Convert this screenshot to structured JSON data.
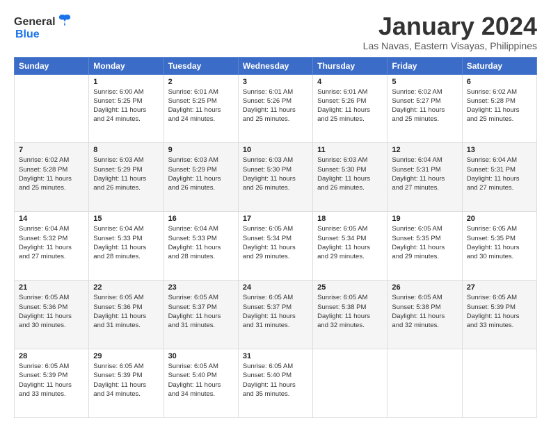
{
  "header": {
    "logo_general": "General",
    "logo_blue": "Blue",
    "title": "January 2024",
    "location": "Las Navas, Eastern Visayas, Philippines"
  },
  "weekdays": [
    "Sunday",
    "Monday",
    "Tuesday",
    "Wednesday",
    "Thursday",
    "Friday",
    "Saturday"
  ],
  "weeks": [
    [
      {
        "day": "",
        "sunrise": "",
        "sunset": "",
        "daylight": ""
      },
      {
        "day": "1",
        "sunrise": "Sunrise: 6:00 AM",
        "sunset": "Sunset: 5:25 PM",
        "daylight": "Daylight: 11 hours and 24 minutes."
      },
      {
        "day": "2",
        "sunrise": "Sunrise: 6:01 AM",
        "sunset": "Sunset: 5:25 PM",
        "daylight": "Daylight: 11 hours and 24 minutes."
      },
      {
        "day": "3",
        "sunrise": "Sunrise: 6:01 AM",
        "sunset": "Sunset: 5:26 PM",
        "daylight": "Daylight: 11 hours and 25 minutes."
      },
      {
        "day": "4",
        "sunrise": "Sunrise: 6:01 AM",
        "sunset": "Sunset: 5:26 PM",
        "daylight": "Daylight: 11 hours and 25 minutes."
      },
      {
        "day": "5",
        "sunrise": "Sunrise: 6:02 AM",
        "sunset": "Sunset: 5:27 PM",
        "daylight": "Daylight: 11 hours and 25 minutes."
      },
      {
        "day": "6",
        "sunrise": "Sunrise: 6:02 AM",
        "sunset": "Sunset: 5:28 PM",
        "daylight": "Daylight: 11 hours and 25 minutes."
      }
    ],
    [
      {
        "day": "7",
        "sunrise": "Sunrise: 6:02 AM",
        "sunset": "Sunset: 5:28 PM",
        "daylight": "Daylight: 11 hours and 25 minutes."
      },
      {
        "day": "8",
        "sunrise": "Sunrise: 6:03 AM",
        "sunset": "Sunset: 5:29 PM",
        "daylight": "Daylight: 11 hours and 26 minutes."
      },
      {
        "day": "9",
        "sunrise": "Sunrise: 6:03 AM",
        "sunset": "Sunset: 5:29 PM",
        "daylight": "Daylight: 11 hours and 26 minutes."
      },
      {
        "day": "10",
        "sunrise": "Sunrise: 6:03 AM",
        "sunset": "Sunset: 5:30 PM",
        "daylight": "Daylight: 11 hours and 26 minutes."
      },
      {
        "day": "11",
        "sunrise": "Sunrise: 6:03 AM",
        "sunset": "Sunset: 5:30 PM",
        "daylight": "Daylight: 11 hours and 26 minutes."
      },
      {
        "day": "12",
        "sunrise": "Sunrise: 6:04 AM",
        "sunset": "Sunset: 5:31 PM",
        "daylight": "Daylight: 11 hours and 27 minutes."
      },
      {
        "day": "13",
        "sunrise": "Sunrise: 6:04 AM",
        "sunset": "Sunset: 5:31 PM",
        "daylight": "Daylight: 11 hours and 27 minutes."
      }
    ],
    [
      {
        "day": "14",
        "sunrise": "Sunrise: 6:04 AM",
        "sunset": "Sunset: 5:32 PM",
        "daylight": "Daylight: 11 hours and 27 minutes."
      },
      {
        "day": "15",
        "sunrise": "Sunrise: 6:04 AM",
        "sunset": "Sunset: 5:33 PM",
        "daylight": "Daylight: 11 hours and 28 minutes."
      },
      {
        "day": "16",
        "sunrise": "Sunrise: 6:04 AM",
        "sunset": "Sunset: 5:33 PM",
        "daylight": "Daylight: 11 hours and 28 minutes."
      },
      {
        "day": "17",
        "sunrise": "Sunrise: 6:05 AM",
        "sunset": "Sunset: 5:34 PM",
        "daylight": "Daylight: 11 hours and 29 minutes."
      },
      {
        "day": "18",
        "sunrise": "Sunrise: 6:05 AM",
        "sunset": "Sunset: 5:34 PM",
        "daylight": "Daylight: 11 hours and 29 minutes."
      },
      {
        "day": "19",
        "sunrise": "Sunrise: 6:05 AM",
        "sunset": "Sunset: 5:35 PM",
        "daylight": "Daylight: 11 hours and 29 minutes."
      },
      {
        "day": "20",
        "sunrise": "Sunrise: 6:05 AM",
        "sunset": "Sunset: 5:35 PM",
        "daylight": "Daylight: 11 hours and 30 minutes."
      }
    ],
    [
      {
        "day": "21",
        "sunrise": "Sunrise: 6:05 AM",
        "sunset": "Sunset: 5:36 PM",
        "daylight": "Daylight: 11 hours and 30 minutes."
      },
      {
        "day": "22",
        "sunrise": "Sunrise: 6:05 AM",
        "sunset": "Sunset: 5:36 PM",
        "daylight": "Daylight: 11 hours and 31 minutes."
      },
      {
        "day": "23",
        "sunrise": "Sunrise: 6:05 AM",
        "sunset": "Sunset: 5:37 PM",
        "daylight": "Daylight: 11 hours and 31 minutes."
      },
      {
        "day": "24",
        "sunrise": "Sunrise: 6:05 AM",
        "sunset": "Sunset: 5:37 PM",
        "daylight": "Daylight: 11 hours and 31 minutes."
      },
      {
        "day": "25",
        "sunrise": "Sunrise: 6:05 AM",
        "sunset": "Sunset: 5:38 PM",
        "daylight": "Daylight: 11 hours and 32 minutes."
      },
      {
        "day": "26",
        "sunrise": "Sunrise: 6:05 AM",
        "sunset": "Sunset: 5:38 PM",
        "daylight": "Daylight: 11 hours and 32 minutes."
      },
      {
        "day": "27",
        "sunrise": "Sunrise: 6:05 AM",
        "sunset": "Sunset: 5:39 PM",
        "daylight": "Daylight: 11 hours and 33 minutes."
      }
    ],
    [
      {
        "day": "28",
        "sunrise": "Sunrise: 6:05 AM",
        "sunset": "Sunset: 5:39 PM",
        "daylight": "Daylight: 11 hours and 33 minutes."
      },
      {
        "day": "29",
        "sunrise": "Sunrise: 6:05 AM",
        "sunset": "Sunset: 5:39 PM",
        "daylight": "Daylight: 11 hours and 34 minutes."
      },
      {
        "day": "30",
        "sunrise": "Sunrise: 6:05 AM",
        "sunset": "Sunset: 5:40 PM",
        "daylight": "Daylight: 11 hours and 34 minutes."
      },
      {
        "day": "31",
        "sunrise": "Sunrise: 6:05 AM",
        "sunset": "Sunset: 5:40 PM",
        "daylight": "Daylight: 11 hours and 35 minutes."
      },
      {
        "day": "",
        "sunrise": "",
        "sunset": "",
        "daylight": ""
      },
      {
        "day": "",
        "sunrise": "",
        "sunset": "",
        "daylight": ""
      },
      {
        "day": "",
        "sunrise": "",
        "sunset": "",
        "daylight": ""
      }
    ]
  ]
}
